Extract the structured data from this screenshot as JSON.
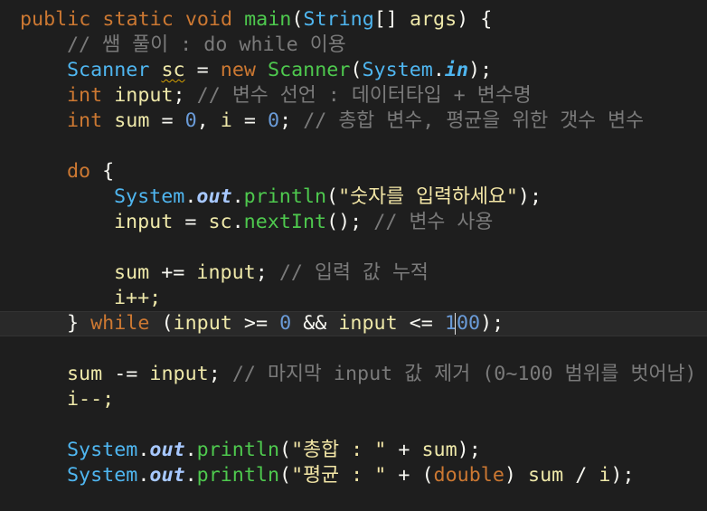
{
  "code": {
    "l1_public": "public",
    "l1_static": "static",
    "l1_void": "void",
    "l1_main": "main",
    "l1_string": "String",
    "l1_brackets": "[]",
    "l1_args": "args",
    "l1_end": ") {",
    "l2_comment": "// 쌤 풀이 : do while 이용",
    "l3_scanner": "Scanner",
    "l3_sc": "sc",
    "l3_eq": "=",
    "l3_new": "new",
    "l3_scanner2": "Scanner",
    "l3_system": "System",
    "l3_in": "in",
    "l4_int": "int",
    "l4_input": "input",
    "l4_comment": "// 변수 선언 : 데이터타입 + 변수명",
    "l5_int": "int",
    "l5_sum": "sum",
    "l5_zero1": "0",
    "l5_i": "i",
    "l5_zero2": "0",
    "l5_comment": "// 총합 변수, 평균을 위한 갯수 변수",
    "l7_do": "do",
    "l8_system": "System",
    "l8_out": "out",
    "l8_println": "println",
    "l8_string": "\"숫자를 입력하세요\"",
    "l9_input": "input",
    "l9_sc": "sc",
    "l9_nextInt": "nextInt",
    "l9_comment": "// 변수 사용",
    "l11_sum": "sum",
    "l11_input": "input",
    "l11_comment": "// 입력 값 누적",
    "l12_i": "i++;",
    "l13_while": "while",
    "l13_input1": "input",
    "l13_zero": "0",
    "l13_input2": "input",
    "l13_hundred": "100",
    "l15_sum": "sum",
    "l15_input": "input",
    "l15_comment": "// 마지막 input 값 제거 (0~100 범위를 벗어남)",
    "l16_i": "i--;",
    "l18_system": "System",
    "l18_out": "out",
    "l18_println": "println",
    "l18_string": "\"총합 : \"",
    "l18_sum": "sum",
    "l19_system": "System",
    "l19_out": "out",
    "l19_println": "println",
    "l19_string": "\"평균 : \"",
    "l19_double": "double",
    "l19_sum": "sum",
    "l19_i": "i"
  },
  "colors": {
    "background": "#1e1e1e",
    "keyword": "#cc7832",
    "method": "#4ec94e",
    "type": "#4fb6f0",
    "variable": "#eee8a9",
    "number": "#6a9bd8",
    "string": "#f3e6a6",
    "comment": "#7a7a7a"
  }
}
